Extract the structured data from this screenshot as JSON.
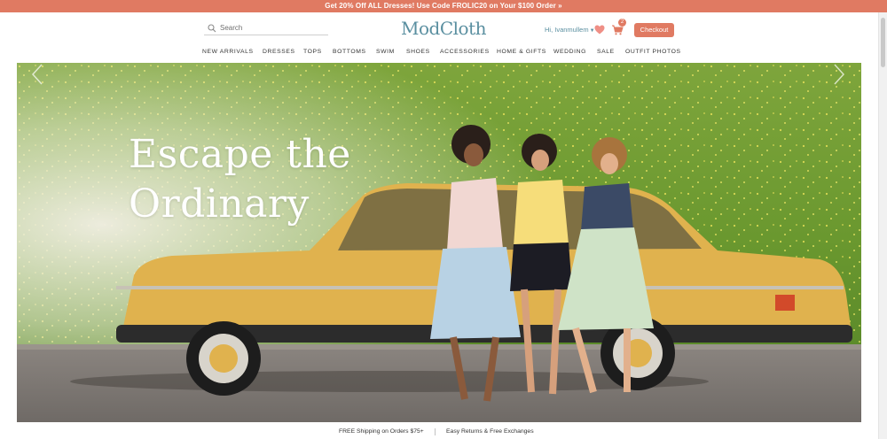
{
  "promo": {
    "text": "Get 20% Off ALL Dresses! Use Code FROLIC20 on Your $100 Order »"
  },
  "header": {
    "search_placeholder": "Search",
    "logo": "ModCloth",
    "user_greeting": "Hi, Ivanmullem",
    "cart_count": "2",
    "checkout_label": "Checkout"
  },
  "nav": {
    "items": [
      "NEW ARRIVALS",
      "DRESSES",
      "TOPS",
      "BOTTOMS",
      "SWIM",
      "SHOES",
      "ACCESSORIES",
      "HOME & GIFTS",
      "WEDDING",
      "SALE",
      "OUTFIT PHOTOS"
    ]
  },
  "hero": {
    "headline_line1": "Escape the",
    "headline_line2": "Ordinary"
  },
  "footer": {
    "shipping": "FREE Shipping on Orders $75+",
    "returns": "Easy Returns & Free Exchanges"
  },
  "colors": {
    "accent": "#e07a62",
    "brand": "#5a8fa0",
    "car": "#e0b24e",
    "grass": "#6f9a32"
  },
  "icons": [
    "search-icon",
    "heart-icon",
    "cart-icon",
    "chevron-left-icon",
    "chevron-right-icon",
    "caret-down-icon"
  ]
}
